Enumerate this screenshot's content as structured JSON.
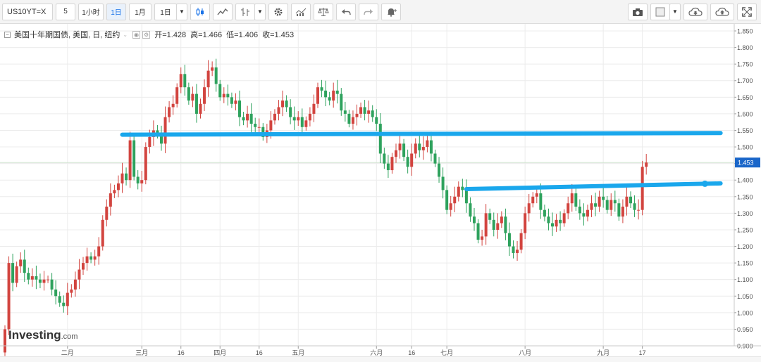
{
  "toolbar": {
    "symbol": "US10YT=X",
    "intervals": [
      "5",
      "1小时",
      "1日",
      "1月",
      "1日"
    ],
    "active_interval_index": 2
  },
  "legend": {
    "name": "美国十年期国债, 美国, 日, 纽约",
    "open_label": "开=",
    "open": "1.428",
    "high_label": "高=",
    "high": "1.466",
    "low_label": "低=",
    "low": "1.406",
    "close_label": "收=",
    "close": "1.453"
  },
  "brand": {
    "name": "Investing",
    "suffix": ".com"
  },
  "icons": {
    "candles": "candlestick-icon",
    "line": "line-chart-icon",
    "indicators": "indicators-icon",
    "settings": "gear-icon",
    "studies": "studies-icon",
    "compare": "scale-icon",
    "undo": "undo-icon",
    "redo": "redo-icon",
    "alert": "alert-bell-icon",
    "camera": "camera-icon",
    "layout": "layout-square-icon",
    "cloud_download": "cloud-download-icon",
    "cloud_upload": "cloud-upload-icon",
    "fullscreen": "fullscreen-icon"
  },
  "colors": {
    "up": "#2ea25d",
    "down": "#d2443f",
    "trendline": "#1aa7ec",
    "price_badge": "#1a66c9",
    "grid": "#ececec"
  },
  "chart_data": {
    "type": "candlestick",
    "title": "",
    "ylim": [
      0.9,
      1.85
    ],
    "y_ticks": [
      0.9,
      0.95,
      1.0,
      1.05,
      1.1,
      1.15,
      1.2,
      1.25,
      1.3,
      1.35,
      1.4,
      1.45,
      1.5,
      1.55,
      1.6,
      1.65,
      1.7,
      1.75,
      1.8,
      1.85
    ],
    "last_price": "1.453",
    "x_tick_labels": [
      "二月",
      "三月",
      "16",
      "四月",
      "16",
      "五月",
      "六月",
      "16",
      "七月",
      "八月",
      "九月",
      "17"
    ],
    "x_tick_bar_index": [
      16,
      35,
      45,
      55,
      65,
      75,
      95,
      104,
      113,
      133,
      153,
      163
    ],
    "close_series": [
      0.95,
      1.15,
      1.09,
      1.14,
      1.16,
      1.12,
      1.1,
      1.11,
      1.1,
      1.09,
      1.1,
      1.1,
      1.07,
      1.05,
      1.03,
      1.02,
      1.06,
      1.07,
      1.1,
      1.13,
      1.15,
      1.17,
      1.16,
      1.17,
      1.2,
      1.28,
      1.32,
      1.36,
      1.37,
      1.39,
      1.42,
      1.4,
      1.52,
      1.41,
      1.39,
      1.4,
      1.5,
      1.53,
      1.55,
      1.54,
      1.51,
      1.59,
      1.62,
      1.63,
      1.68,
      1.72,
      1.68,
      1.64,
      1.66,
      1.6,
      1.63,
      1.68,
      1.73,
      1.74,
      1.69,
      1.65,
      1.66,
      1.65,
      1.63,
      1.64,
      1.59,
      1.58,
      1.6,
      1.57,
      1.56,
      1.56,
      1.53,
      1.55,
      1.58,
      1.6,
      1.62,
      1.64,
      1.62,
      1.59,
      1.58,
      1.59,
      1.56,
      1.58,
      1.6,
      1.63,
      1.68,
      1.67,
      1.65,
      1.64,
      1.67,
      1.66,
      1.61,
      1.6,
      1.57,
      1.59,
      1.6,
      1.62,
      1.6,
      1.61,
      1.59,
      1.57,
      1.48,
      1.45,
      1.43,
      1.47,
      1.49,
      1.51,
      1.47,
      1.44,
      1.48,
      1.51,
      1.49,
      1.5,
      1.52,
      1.48,
      1.45,
      1.41,
      1.37,
      1.31,
      1.33,
      1.35,
      1.38,
      1.37,
      1.33,
      1.29,
      1.27,
      1.22,
      1.23,
      1.3,
      1.28,
      1.25,
      1.27,
      1.29,
      1.24,
      1.2,
      1.18,
      1.19,
      1.24,
      1.3,
      1.33,
      1.35,
      1.36,
      1.31,
      1.29,
      1.27,
      1.26,
      1.28,
      1.27,
      1.3,
      1.33,
      1.36,
      1.32,
      1.3,
      1.29,
      1.31,
      1.33,
      1.32,
      1.35,
      1.34,
      1.31,
      1.34,
      1.33,
      1.29,
      1.32,
      1.35,
      1.33,
      1.31,
      1.31,
      1.44,
      1.453
    ],
    "annotations": [
      {
        "type": "trendline",
        "x_bar": [
          30,
          183
        ],
        "y": [
          1.537,
          1.542
        ]
      },
      {
        "type": "trendline",
        "x_bar": [
          118,
          183
        ],
        "y": [
          1.373,
          1.39
        ]
      }
    ]
  }
}
